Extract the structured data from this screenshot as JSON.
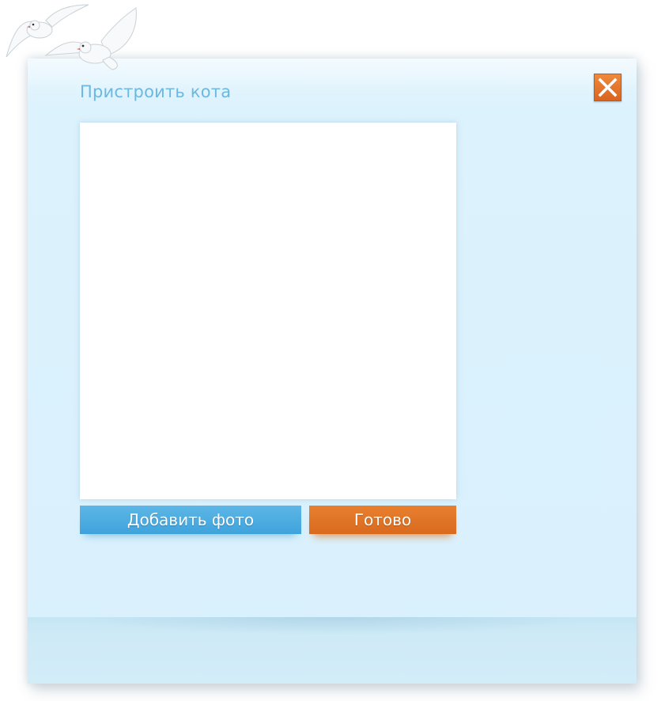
{
  "dialog": {
    "title": "Пристроить кота",
    "close_icon": "close-icon",
    "photo_area": "",
    "buttons": {
      "add_photo_label": "Добавить фото",
      "done_label": "Готово"
    }
  },
  "decoration": {
    "icon": "doves-icon"
  },
  "colors": {
    "title": "#6bb8e3",
    "dialog_background": "#d9f1fd",
    "add_button": "#4aabe0",
    "done_button": "#e07426",
    "close_button": "#e07426"
  }
}
